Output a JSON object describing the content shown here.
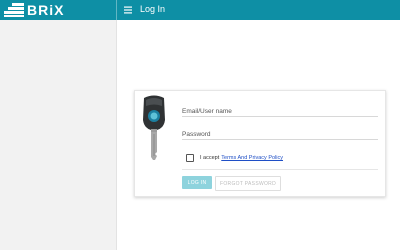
{
  "header": {
    "brand": "BRiX",
    "title": "Log In",
    "colors": {
      "bar": "#0e8fa5",
      "text": "#ffffff"
    }
  },
  "login": {
    "email_placeholder": "Email/User name",
    "password_placeholder": "Password",
    "accept_text": "I accept",
    "terms_link": "Terms And Privacy Policy",
    "login_button": "LOG IN",
    "forgot_button": "FORGOT PASSWORD"
  },
  "icons": {
    "menu": "hamburger-menu-icon",
    "logo": "brix-logo-mark",
    "illustration": "key-icon"
  },
  "colors": {
    "accent": "#0e8fa5",
    "login_button": "#8ed3dd",
    "link": "#1f4fc6"
  }
}
